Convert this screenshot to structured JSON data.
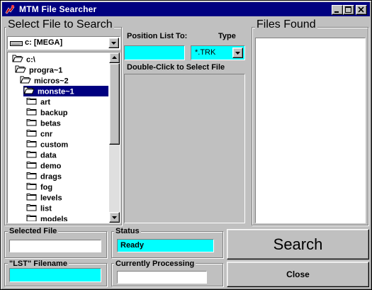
{
  "window": {
    "title": "MTM File Searcher"
  },
  "select_section": {
    "label": "Select File to Search",
    "drive": "c: [MEGA]",
    "dirs": [
      {
        "label": "c:\\",
        "icon": "open-folder-icon",
        "indent": 0,
        "selected": false
      },
      {
        "label": "progra~1",
        "icon": "open-folder-icon",
        "indent": 1,
        "selected": false
      },
      {
        "label": "micros~2",
        "icon": "open-folder-icon",
        "indent": 2,
        "selected": false
      },
      {
        "label": "monste~1",
        "icon": "open-folder-icon",
        "indent": 3,
        "selected": true
      },
      {
        "label": "art",
        "icon": "folder-icon",
        "indent": 4,
        "selected": false
      },
      {
        "label": "backup",
        "icon": "folder-icon",
        "indent": 4,
        "selected": false
      },
      {
        "label": "betas",
        "icon": "folder-icon",
        "indent": 4,
        "selected": false
      },
      {
        "label": "cnr",
        "icon": "folder-icon",
        "indent": 4,
        "selected": false
      },
      {
        "label": "custom",
        "icon": "folder-icon",
        "indent": 4,
        "selected": false
      },
      {
        "label": "data",
        "icon": "folder-icon",
        "indent": 4,
        "selected": false
      },
      {
        "label": "demo",
        "icon": "folder-icon",
        "indent": 4,
        "selected": false
      },
      {
        "label": "drags",
        "icon": "folder-icon",
        "indent": 4,
        "selected": false
      },
      {
        "label": "fog",
        "icon": "folder-icon",
        "indent": 4,
        "selected": false
      },
      {
        "label": "levels",
        "icon": "folder-icon",
        "indent": 4,
        "selected": false
      },
      {
        "label": "list",
        "icon": "folder-icon",
        "indent": 4,
        "selected": false
      },
      {
        "label": "models",
        "icon": "folder-icon",
        "indent": 4,
        "selected": false
      }
    ],
    "position_label": "Position List To:",
    "position_value": "",
    "type_label": "Type",
    "type_value": "*.TRK",
    "file_list_label": "Double-Click to Select File"
  },
  "files_found": {
    "label": "Files Found"
  },
  "selected_file": {
    "label": "Selected File",
    "value": ""
  },
  "lst_filename": {
    "label": "\"LST\" Filename",
    "value": ""
  },
  "status": {
    "label": "Status",
    "value": "Ready"
  },
  "processing": {
    "label": "Currently Processing",
    "value": ""
  },
  "buttons": {
    "search": "Search",
    "close": "Close"
  },
  "colors": {
    "titlebar": "#000080",
    "field_highlight": "#00ffff",
    "face": "#c0c0c0"
  }
}
